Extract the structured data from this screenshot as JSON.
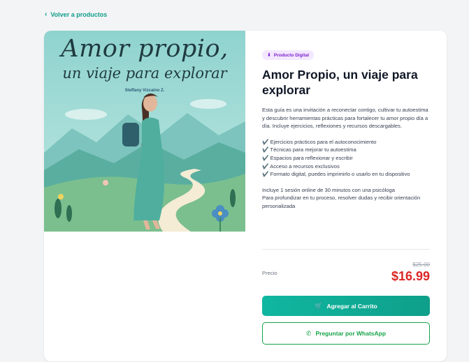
{
  "nav": {
    "back_label": "Volver a productos"
  },
  "product": {
    "cover": {
      "title_line1": "Amor propio,",
      "title_line2": "un viaje para explorar",
      "author": "Steffany Vizcaino Z."
    },
    "badge": "Producto Digital",
    "title": "Amor Propio, un viaje para explorar",
    "description": "Esta guía es una invitación a reconectar contigo, cultivar tu autoestima y descubrir herramientas prácticas para fortalecer tu amor propio día a día. Incluye ejercicios, reflexiones y recursos descargables.",
    "features": [
      "✔️ Ejercicios prácticos para el autoconocimiento",
      "✔️ Técnicas para mejorar tu autoestima",
      "✔️ Espacios para reflexionar y escribir",
      "✔️ Acceso a recursos exclusivos",
      "✔️ Formato digital, puedes imprimirlo o usarlo en tu dispositivo"
    ],
    "session_line1": "Incluye 1 sesión online de 30 minutos con una psicóloga",
    "session_line2": "Para profundizar en tu proceso, resolver dudas y recibir orientación personalizada",
    "price_label": "Precio",
    "old_price": "$25.00",
    "price": "$16.99"
  },
  "actions": {
    "add_to_cart": "Agregar al Carrito",
    "whatsapp": "Preguntar por WhatsApp"
  },
  "colors": {
    "accent": "#0f9d8a",
    "price": "#dc2626",
    "whatsapp": "#16a34a",
    "badge_text": "#7e22ce",
    "badge_bg": "#f3e8ff"
  },
  "icons": {
    "back": "chevron-left-icon",
    "badge": "download-icon",
    "cart": "cart-icon",
    "whatsapp": "whatsapp-icon"
  }
}
